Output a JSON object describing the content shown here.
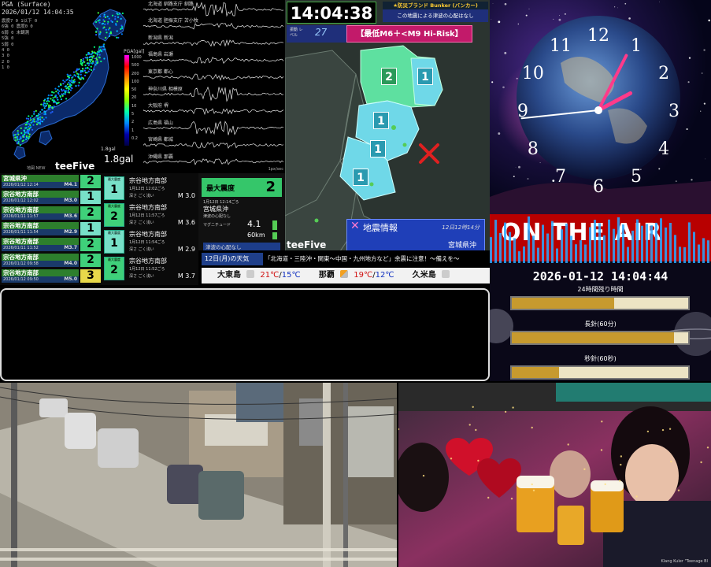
{
  "pga": {
    "header_line1": "PGA (Surface)",
    "header_line2": "2026/01/12 14:04:35",
    "stats": [
      "震度7 0   1以下 0",
      "6強 0     震度0 0",
      "6弱 0     未観測",
      "5強 0",
      "5弱 0",
      "4   0",
      "3   0",
      "2   0",
      "1   0"
    ],
    "scale_title": "PGA[gal]",
    "scale_labels": [
      "1000",
      "500",
      "200",
      "100",
      "50",
      "20",
      "10",
      "5",
      "2",
      "1",
      "0.2"
    ],
    "gal_label": "1.8gal",
    "value": "1.8gal",
    "brand": "teeFive",
    "credit": "地図 NEW",
    "wave_stations": [
      "北海道 釧路支庁 釧路",
      "北海道 胆振支庁 苫小牧",
      "新潟県 新潟",
      "福島県 岩瀬",
      "東京都 都心",
      "神奈川県 相模原",
      "大阪府 堺",
      "広島県 福山",
      "宮崎県 都城",
      "沖縄県 那覇"
    ],
    "wave_unit": "1px/sec"
  },
  "quake_list": [
    {
      "region": "宮城県沖",
      "time": "2026/01/12 12:14",
      "mag": "M4.1",
      "intensity": "2"
    },
    {
      "region": "宗谷地方南部",
      "time": "2026/01/12 12:02",
      "mag": "M3.0",
      "intensity": "1"
    },
    {
      "region": "宗谷地方南部",
      "time": "2026/01/11 11:57",
      "mag": "M3.6",
      "intensity": "2"
    },
    {
      "region": "宗谷地方南部",
      "time": "2026/01/11 11:54",
      "mag": "M2.9",
      "intensity": "1"
    },
    {
      "region": "宗谷地方南部",
      "time": "2026/01/11 11:52",
      "mag": "M3.7",
      "intensity": "2"
    },
    {
      "region": "宗谷地方南部",
      "time": "2026/01/12 09:58",
      "mag": "M4.0",
      "intensity": "2"
    },
    {
      "region": "宗谷地方南部",
      "time": "2026/01/12 09:50",
      "mag": "M5.0",
      "intensity": "3"
    }
  ],
  "quake_cards": [
    {
      "badge_label": "最大震度",
      "intensity": "1",
      "region": "宗谷地方南部",
      "time": "1月12日 12:02ごろ",
      "depth": "深さ ごく浅い",
      "mag": "M 3.0"
    },
    {
      "badge_label": "最大震度",
      "intensity": "2",
      "region": "宗谷地方南部",
      "time": "1月12日 11:57ごろ",
      "depth": "深さ ごく浅い",
      "mag": "M 3.6"
    },
    {
      "badge_label": "最大震度",
      "intensity": "1",
      "region": "宗谷地方南部",
      "time": "1月12日 11:54ごろ",
      "depth": "深さ ごく浅い",
      "mag": "M 2.9"
    },
    {
      "badge_label": "最大震度",
      "intensity": "2",
      "region": "宗谷地方南部",
      "time": "1月12日 11:52ごろ",
      "depth": "深さ ごく浅い",
      "mag": "M 3.7"
    }
  ],
  "max_intensity": {
    "label": "最大震度",
    "value": "2",
    "time": "1月12日 12:14ごろ",
    "region": "宮城県沖",
    "note": "津波の心配なし",
    "mag_label": "マグニチュード",
    "mag": "4.1",
    "depth": "60km",
    "tsunami": "津波の心配なし"
  },
  "region_map": {
    "clock": "14:04:38",
    "bunker_title": "★防災ブランド Bunker (バンカー)",
    "bunker_msg": "この地震による津波の心配はなし",
    "level_label": "振動 レベル",
    "level_value": "27",
    "risk": "【最低M6＋<M9 Hi-Risk】",
    "badges": [
      "2",
      "1",
      "1",
      "1",
      "1"
    ],
    "info_title": "地震情報",
    "info_time": "12日12時14分",
    "info_region": "宮城県沖",
    "brand": "teeFive"
  },
  "weather": {
    "date": "12日(月)の天気",
    "ticker": "「北海道・三陸沖・関東～中国・九州地方など」余震に注意！～備えを～",
    "cities": [
      {
        "name": "大東島",
        "hi": "21℃",
        "lo": "15℃"
      },
      {
        "name": "那覇",
        "hi": "19℃",
        "lo": "12℃"
      },
      {
        "name": "久米島",
        "hi": "",
        "lo": ""
      }
    ]
  },
  "clock_face": {
    "numerals": [
      "12",
      "1",
      "2",
      "3",
      "4",
      "5",
      "6",
      "7",
      "8",
      "9",
      "10",
      "11"
    ]
  },
  "onair": {
    "title": "ON THE AIR",
    "datetime": "2026-01-12 14:04:44",
    "progress": [
      {
        "label": "24時間残り時間",
        "percent": 58
      },
      {
        "label": "長針(60分)",
        "percent": 92
      },
      {
        "label": "秒針(60秒)",
        "percent": 27
      }
    ]
  },
  "party": {
    "credit": "Klang Kuler \"Teenage Bl"
  },
  "colors": {
    "intensity_1": "#78e0c8",
    "intensity_2": "#3fd07a",
    "intensity_3": "#e8d84a",
    "onair_red": "#b80000",
    "progress_fill": "#c79a2e"
  }
}
